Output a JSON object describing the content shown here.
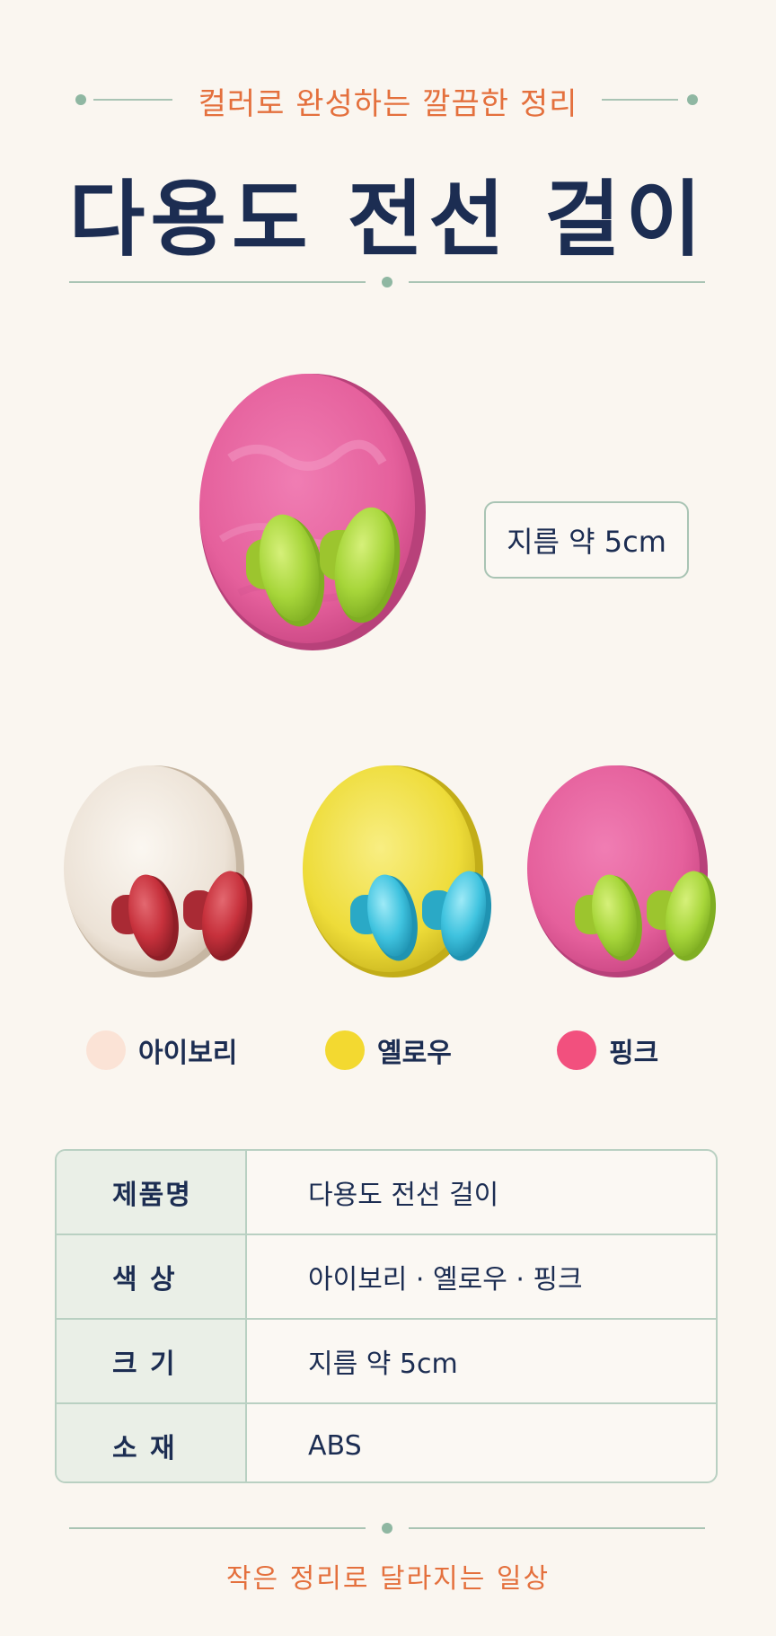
{
  "header": {
    "subtitle": "컬러로 완성하는 깔끔한 정리",
    "title": "다용도 전선 걸이"
  },
  "product": {
    "size_label": "지름 약 5cm"
  },
  "colors": [
    {
      "label": "아이보리",
      "swatch": "#fbe3d6",
      "plate": "#efe6dc",
      "knob": "#c7313c"
    },
    {
      "label": "옐로우",
      "swatch": "#f3d930",
      "plate": "#f1e145",
      "knob": "#3fc3df"
    },
    {
      "label": "핑크",
      "swatch": "#f2507e",
      "plate": "#e8619d",
      "knob": "#a9d83e"
    }
  ],
  "specs": {
    "rows": [
      {
        "key": "제품명",
        "value": "다용도 전선 걸이"
      },
      {
        "key": "색 상",
        "value": "아이보리 · 옐로우 · 핑크"
      },
      {
        "key": "크 기",
        "value": "지름 약 5cm"
      },
      {
        "key": "소 재",
        "value": "ABS"
      }
    ]
  },
  "footer": {
    "text": "작은 정리로 달라지는 일상"
  }
}
